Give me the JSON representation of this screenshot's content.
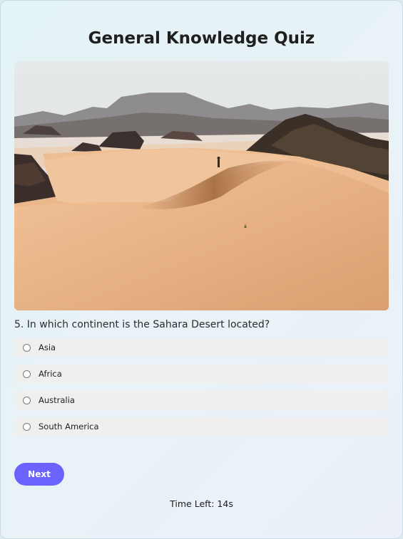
{
  "quiz": {
    "title": "General Knowledge Quiz",
    "image": {
      "subject": "desert sand dunes with a lone hiker"
    },
    "question": "5. In which continent is the Sahara Desert located?",
    "options": [
      {
        "label": "Asia",
        "selected": false
      },
      {
        "label": "Africa",
        "selected": false
      },
      {
        "label": "Australia",
        "selected": false
      },
      {
        "label": "South America",
        "selected": false
      }
    ],
    "next_label": "Next",
    "timer_text": "Time Left: 14s"
  },
  "colors": {
    "accent": "#6c63ff",
    "option_bg": "#efefef",
    "sand": "#e2ad7d"
  }
}
